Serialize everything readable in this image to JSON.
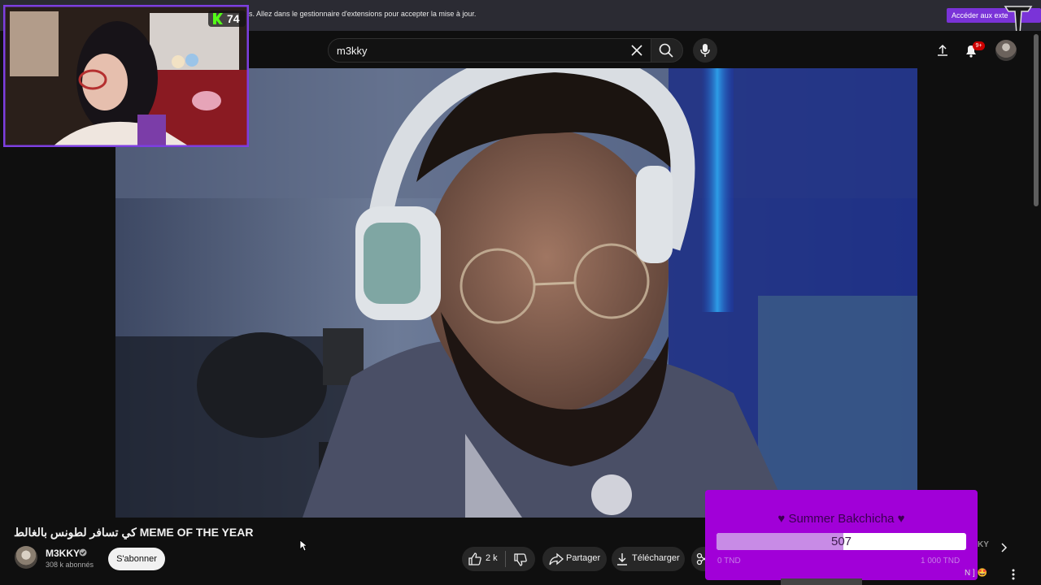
{
  "banner": {
    "text": "s. Allez dans le gestionnaire d'extensions pour accepter la mise à jour.",
    "button_label": "Accéder aux exte"
  },
  "header": {
    "search_value": "m3kky",
    "notification_count": "9+"
  },
  "stream_overlay": {
    "viewer_count": "74",
    "viewer_icon": "kick-icon"
  },
  "video": {
    "title": "كي تسافر لطونس بالغالط MEME OF THE YEAR",
    "channel_name": "M3KKY",
    "subscribers": "308 k abonnés",
    "subscribe_label": "S'abonner",
    "like_count": "2 k",
    "share_label": "Partager",
    "download_label": "Télécharger"
  },
  "donation_goal": {
    "title": "♥ Summer Bakchicha ♥",
    "current_value": "507",
    "min_label": "0 TND",
    "max_label": "1 000 TND",
    "progress_fraction": 0.507,
    "bar_color": "#c88be6",
    "panel_color": "#a100d8"
  },
  "sidebar": {
    "partial_label": "KY",
    "rec_title": "N ] 🤩"
  },
  "colors": {
    "accent": "#7a33d8",
    "notif_red": "#cc0000"
  }
}
